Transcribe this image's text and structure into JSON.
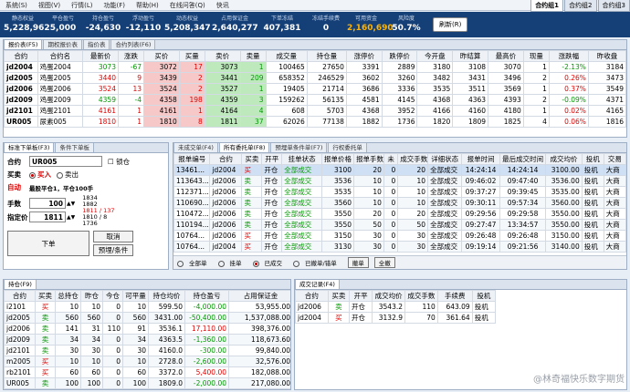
{
  "menu": [
    "系统(S)",
    "视图(V)",
    "行情(L)",
    "功能(F)",
    "帮助(H)",
    "在线问答(Q)",
    "快讯"
  ],
  "right_tabs": [
    "合约组1",
    "合约组2",
    "合约组3"
  ],
  "summary": {
    "stats": [
      {
        "label": "静态权益",
        "value": "5,228,962"
      },
      {
        "label": "平仓盈亏",
        "value": "5,000"
      },
      {
        "label": "持仓盈亏",
        "value": "-24,630"
      },
      {
        "label": "浮动盈亏",
        "value": "-12,110"
      },
      {
        "label": "动态权益",
        "value": "5,208,347"
      },
      {
        "label": "占用保证金",
        "value": "2,640,277"
      },
      {
        "label": "下单冻结",
        "value": "407,381"
      },
      {
        "label": "冻结手续费",
        "value": "0"
      },
      {
        "label": "可用资金",
        "value": "2,160,690"
      },
      {
        "label": "风险度",
        "value": "50.7%"
      }
    ],
    "refresh_label": "刷新(R)"
  },
  "colors": {
    "header_bg": "#153f77",
    "up": "#e00000",
    "down": "#009900",
    "available": "#ffb400"
  },
  "quote": {
    "tabs": [
      "报价表(F5)",
      "期权报价表",
      "指价表",
      "合约列表(F6)"
    ],
    "headers": [
      "合约",
      "合约名",
      "最新价",
      "涨跌",
      "买价",
      "买量",
      "卖价",
      "卖量",
      "成交量",
      "持仓量",
      "涨停价",
      "跌停价",
      "今开盘",
      "昨结算",
      "最高价",
      "现量",
      "涨跌幅",
      "昨收盘"
    ],
    "rows": [
      [
        "jd2004",
        "鸡蛋2004",
        "3073",
        "-67",
        "3072",
        "17",
        "3073",
        "1",
        "100465",
        "27650",
        "3391",
        "2889",
        "3180",
        "3108",
        "3070",
        "1",
        "-2.13%",
        "3184"
      ],
      [
        "jd2005",
        "鸡蛋2005",
        "3440",
        "9",
        "3439",
        "2",
        "3441",
        "209",
        "658352",
        "246529",
        "3602",
        "3260",
        "3482",
        "3431",
        "3496",
        "2",
        "0.26%",
        "3473"
      ],
      [
        "jd2006",
        "鸡蛋2006",
        "3524",
        "13",
        "3524",
        "2",
        "3527",
        "1",
        "19405",
        "21714",
        "3686",
        "3336",
        "3535",
        "3511",
        "3569",
        "1",
        "0.37%",
        "3549"
      ],
      [
        "jd2009",
        "鸡蛋2009",
        "4359",
        "-4",
        "4358",
        "198",
        "4359",
        "3",
        "159262",
        "56135",
        "4581",
        "4145",
        "4368",
        "4363",
        "4393",
        "2",
        "-0.09%",
        "4371"
      ],
      [
        "jd2101",
        "鸡蛋2101",
        "4161",
        "1",
        "4161",
        "1",
        "4164",
        "4",
        "608",
        "5703",
        "4368",
        "3952",
        "4166",
        "4160",
        "4180",
        "1",
        "0.02%",
        "4165"
      ],
      [
        "UR005",
        "尿素005",
        "1810",
        "1",
        "1810",
        "8",
        "1811",
        "37",
        "62026",
        "77138",
        "1882",
        "1736",
        "1820",
        "1809",
        "1825",
        "4",
        "0.06%",
        "1816"
      ]
    ]
  },
  "order": {
    "tabs": [
      "标准下单板(F3)",
      "条件下单板"
    ],
    "contract_label": "合约",
    "contract": "UR005",
    "lock_label": "锁仓",
    "side_label": "买卖",
    "buy_label": "买入",
    "sell_label": "卖出",
    "auto_label": "自动",
    "auto_note": "最股平仓1，平仓100手",
    "qty_label": "手数",
    "qty": "100",
    "price_label": "指定价",
    "price": "1811",
    "ladder": [
      "1834",
      "1882",
      "1811 / 137",
      "1810 / 8",
      "1736"
    ],
    "submit": "下单",
    "cancel": "取消",
    "advanced": "预埋/条件"
  },
  "orders": {
    "tabs": [
      "未成交单(F4)",
      "所有委托单(F8)",
      "预埋单条件单(F7)",
      "行权委托单"
    ],
    "headers": [
      "报单编号",
      "合约",
      "买卖",
      "开平",
      "挂单状态",
      "报单价格",
      "报单手数",
      "未",
      "成交手数",
      "详细状态",
      "报单时间",
      "最后成交时间",
      "成交均价",
      "投机",
      "交易"
    ],
    "rows": [
      [
        "13461...",
        "jd2004",
        "买",
        "开仓",
        "全部成交",
        "3100",
        "20",
        "0",
        "20",
        "全部成交",
        "14:24:14",
        "14:24:14",
        "3100.00",
        "投机",
        "大商"
      ],
      [
        "113643...",
        "jd2006",
        "卖",
        "开仓",
        "全部成交",
        "3536",
        "10",
        "0",
        "10",
        "全部成交",
        "09:46:02",
        "09:47:40",
        "3536.00",
        "投机",
        "大商"
      ],
      [
        "112371...",
        "jd2006",
        "卖",
        "开仓",
        "全部成交",
        "3535",
        "10",
        "0",
        "10",
        "全部成交",
        "09:37:27",
        "09:39:45",
        "3535.00",
        "投机",
        "大商"
      ],
      [
        "110690...",
        "jd2006",
        "卖",
        "开仓",
        "全部成交",
        "3560",
        "10",
        "0",
        "10",
        "全部成交",
        "09:30:11",
        "09:57:34",
        "3560.00",
        "投机",
        "大商"
      ],
      [
        "110472...",
        "jd2006",
        "卖",
        "开仓",
        "全部成交",
        "3550",
        "20",
        "0",
        "20",
        "全部成交",
        "09:29:56",
        "09:29:58",
        "3550.00",
        "投机",
        "大商"
      ],
      [
        "110194...",
        "jd2006",
        "卖",
        "开仓",
        "全部成交",
        "3550",
        "50",
        "0",
        "50",
        "全部成交",
        "09:27:47",
        "13:34:57",
        "3550.00",
        "投机",
        "大商"
      ],
      [
        "10764...",
        "jd2006",
        "买",
        "开仓",
        "全部成交",
        "3150",
        "30",
        "0",
        "30",
        "全部成交",
        "09:26:48",
        "09:26:48",
        "3150.00",
        "投机",
        "大商"
      ],
      [
        "10764...",
        "jd2004",
        "买",
        "开仓",
        "全部成交",
        "3130",
        "30",
        "0",
        "30",
        "全部成交",
        "09:19:14",
        "09:21:56",
        "3140.00",
        "投机",
        "大商"
      ]
    ],
    "filters": [
      "全部单",
      "挂单",
      "已成交",
      "已撤单/错单"
    ],
    "cancel_btn": "撤单",
    "cancel_all_btn": "全撤"
  },
  "positions": {
    "tabs": [
      "持仓(F9)"
    ],
    "headers": [
      "合约",
      "买卖",
      "总持仓",
      "昨仓",
      "今仓",
      "可平量",
      "持仓均价",
      "持仓盈亏",
      "占用保证金"
    ],
    "rows": [
      [
        "i2101",
        "买",
        "10",
        "10",
        "0",
        "10",
        "599.50",
        "-4,000.00",
        "53,955.00"
      ],
      [
        "jd2005",
        "卖",
        "560",
        "560",
        "0",
        "560",
        "3431.00",
        "-50,400.00",
        "1,537,088.00"
      ],
      [
        "jd2006",
        "卖",
        "141",
        "31",
        "110",
        "91",
        "3536.1",
        "17,110.00",
        "398,376.00"
      ],
      [
        "jd2009",
        "卖",
        "34",
        "34",
        "0",
        "34",
        "4363.5",
        "-1,360.00",
        "118,673.60"
      ],
      [
        "jd2101",
        "卖",
        "30",
        "30",
        "0",
        "30",
        "4160.0",
        "-300.00",
        "99,840.00"
      ],
      [
        "m2005",
        "买",
        "10",
        "10",
        "0",
        "10",
        "2728.0",
        "-2,600.00",
        "32,576.00"
      ],
      [
        "rb2101",
        "买",
        "60",
        "60",
        "0",
        "60",
        "3372.0",
        "5,400.00",
        "182,088.00"
      ],
      [
        "UR005",
        "卖",
        "100",
        "100",
        "0",
        "100",
        "1809.0",
        "-2,000.00",
        "217,080.00"
      ]
    ]
  },
  "trades": {
    "tabs": [
      "成交记录(F4)"
    ],
    "headers": [
      "合约",
      "买卖",
      "开平",
      "成交均价",
      "成交手数",
      "手续费",
      "投机"
    ],
    "rows": [
      [
        "jd2006",
        "卖",
        "开仓",
        "3543.2",
        "110",
        "643.09",
        "投机"
      ],
      [
        "jd2004",
        "买",
        "开仓",
        "3132.9",
        "70",
        "361.64",
        "投机"
      ]
    ]
  },
  "watermark": "@林奇福快乐数字期货"
}
